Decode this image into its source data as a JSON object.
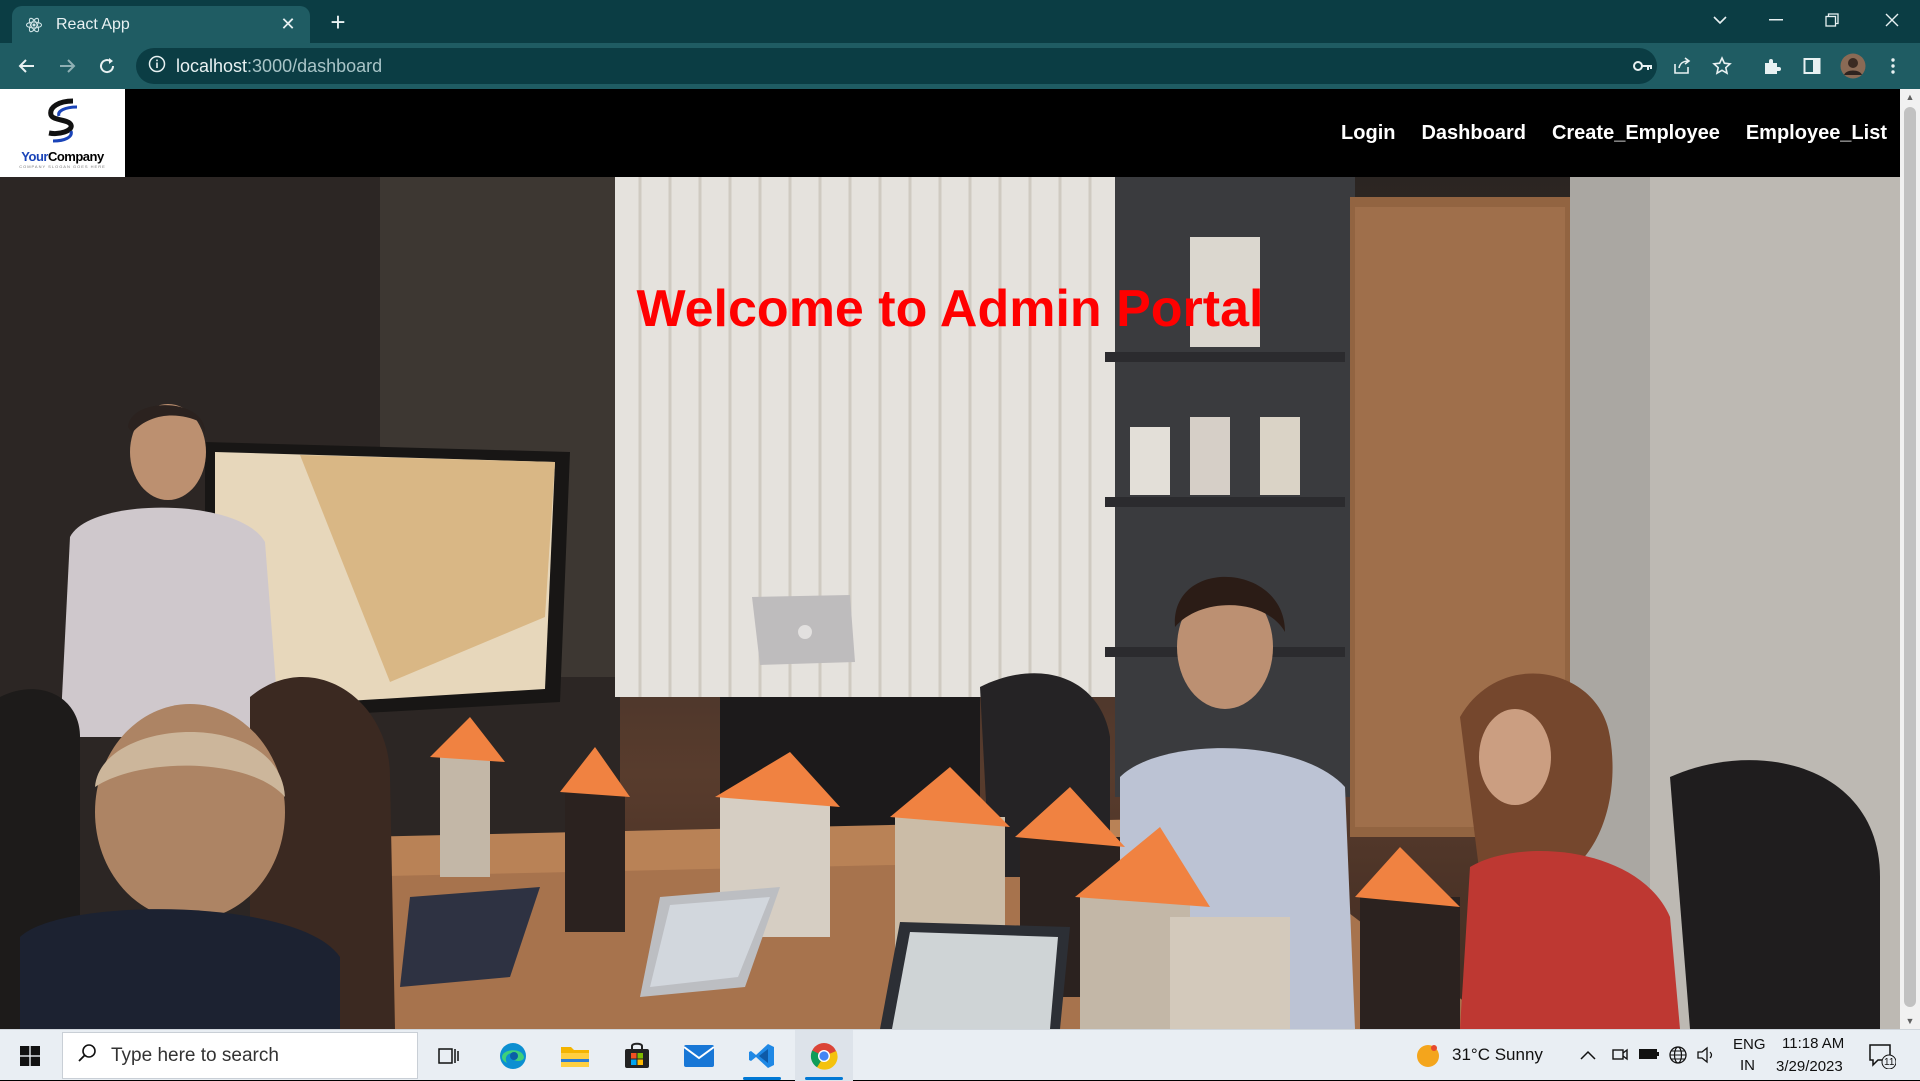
{
  "browser": {
    "tab_title": "React App",
    "url_host": "localhost",
    "url_path": ":3000/dashboard"
  },
  "app": {
    "logo": {
      "brand_part1": "Your",
      "brand_part2": "Company",
      "tagline": "COMPANY SLOGAN GOES HERE"
    },
    "nav": [
      {
        "label": "Login"
      },
      {
        "label": "Dashboard"
      },
      {
        "label": "Create_Employee"
      },
      {
        "label": "Employee_List"
      }
    ],
    "hero_title": "Welcome to Admin Portal",
    "hero_title_color": "#ff0000"
  },
  "taskbar": {
    "search_placeholder": "Type here to search",
    "weather": "31°C  Sunny",
    "lang_line1": "ENG",
    "lang_line2": "IN",
    "time": "11:18 AM",
    "date": "3/29/2023",
    "notification_count": "11"
  },
  "colors": {
    "browser_frame": "#0b3d44",
    "browser_toolbar": "#1f5c63",
    "navbar_bg": "#000000"
  }
}
